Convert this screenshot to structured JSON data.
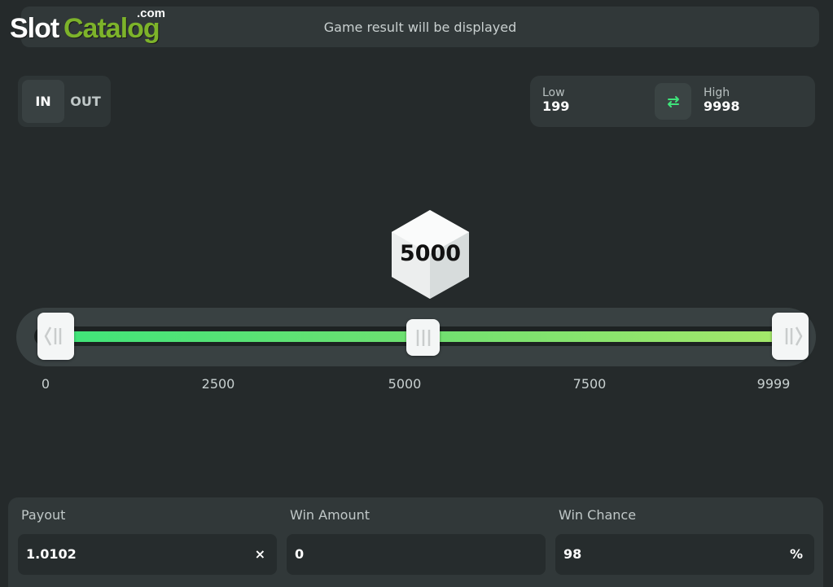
{
  "logo": {
    "slot": "Slot",
    "catalog": "Catalog",
    "com": ".com"
  },
  "result_bar": {
    "text": "Game result will be displayed"
  },
  "mode": {
    "in_label": "IN",
    "out_label": "OUT",
    "selected": "IN"
  },
  "range": {
    "low_label": "Low",
    "low_value": "199",
    "high_label": "High",
    "high_value": "9998",
    "swap_icon": "swap-arrows-icon"
  },
  "result_cube": {
    "value": "5000"
  },
  "slider": {
    "ticks": [
      "0",
      "2500",
      "5000",
      "7500",
      "9999"
    ],
    "min": 0,
    "max": 9999,
    "low": 199,
    "high": 9998,
    "marker": 5000,
    "colors": {
      "start": "#3fe47a",
      "end": "#a6e86a"
    }
  },
  "stats": {
    "payout": {
      "label": "Payout",
      "value": "1.0102",
      "unit": "×"
    },
    "win_amount": {
      "label": "Win Amount",
      "value": "0"
    },
    "win_chance": {
      "label": "Win Chance",
      "value": "98",
      "unit": "%"
    }
  }
}
